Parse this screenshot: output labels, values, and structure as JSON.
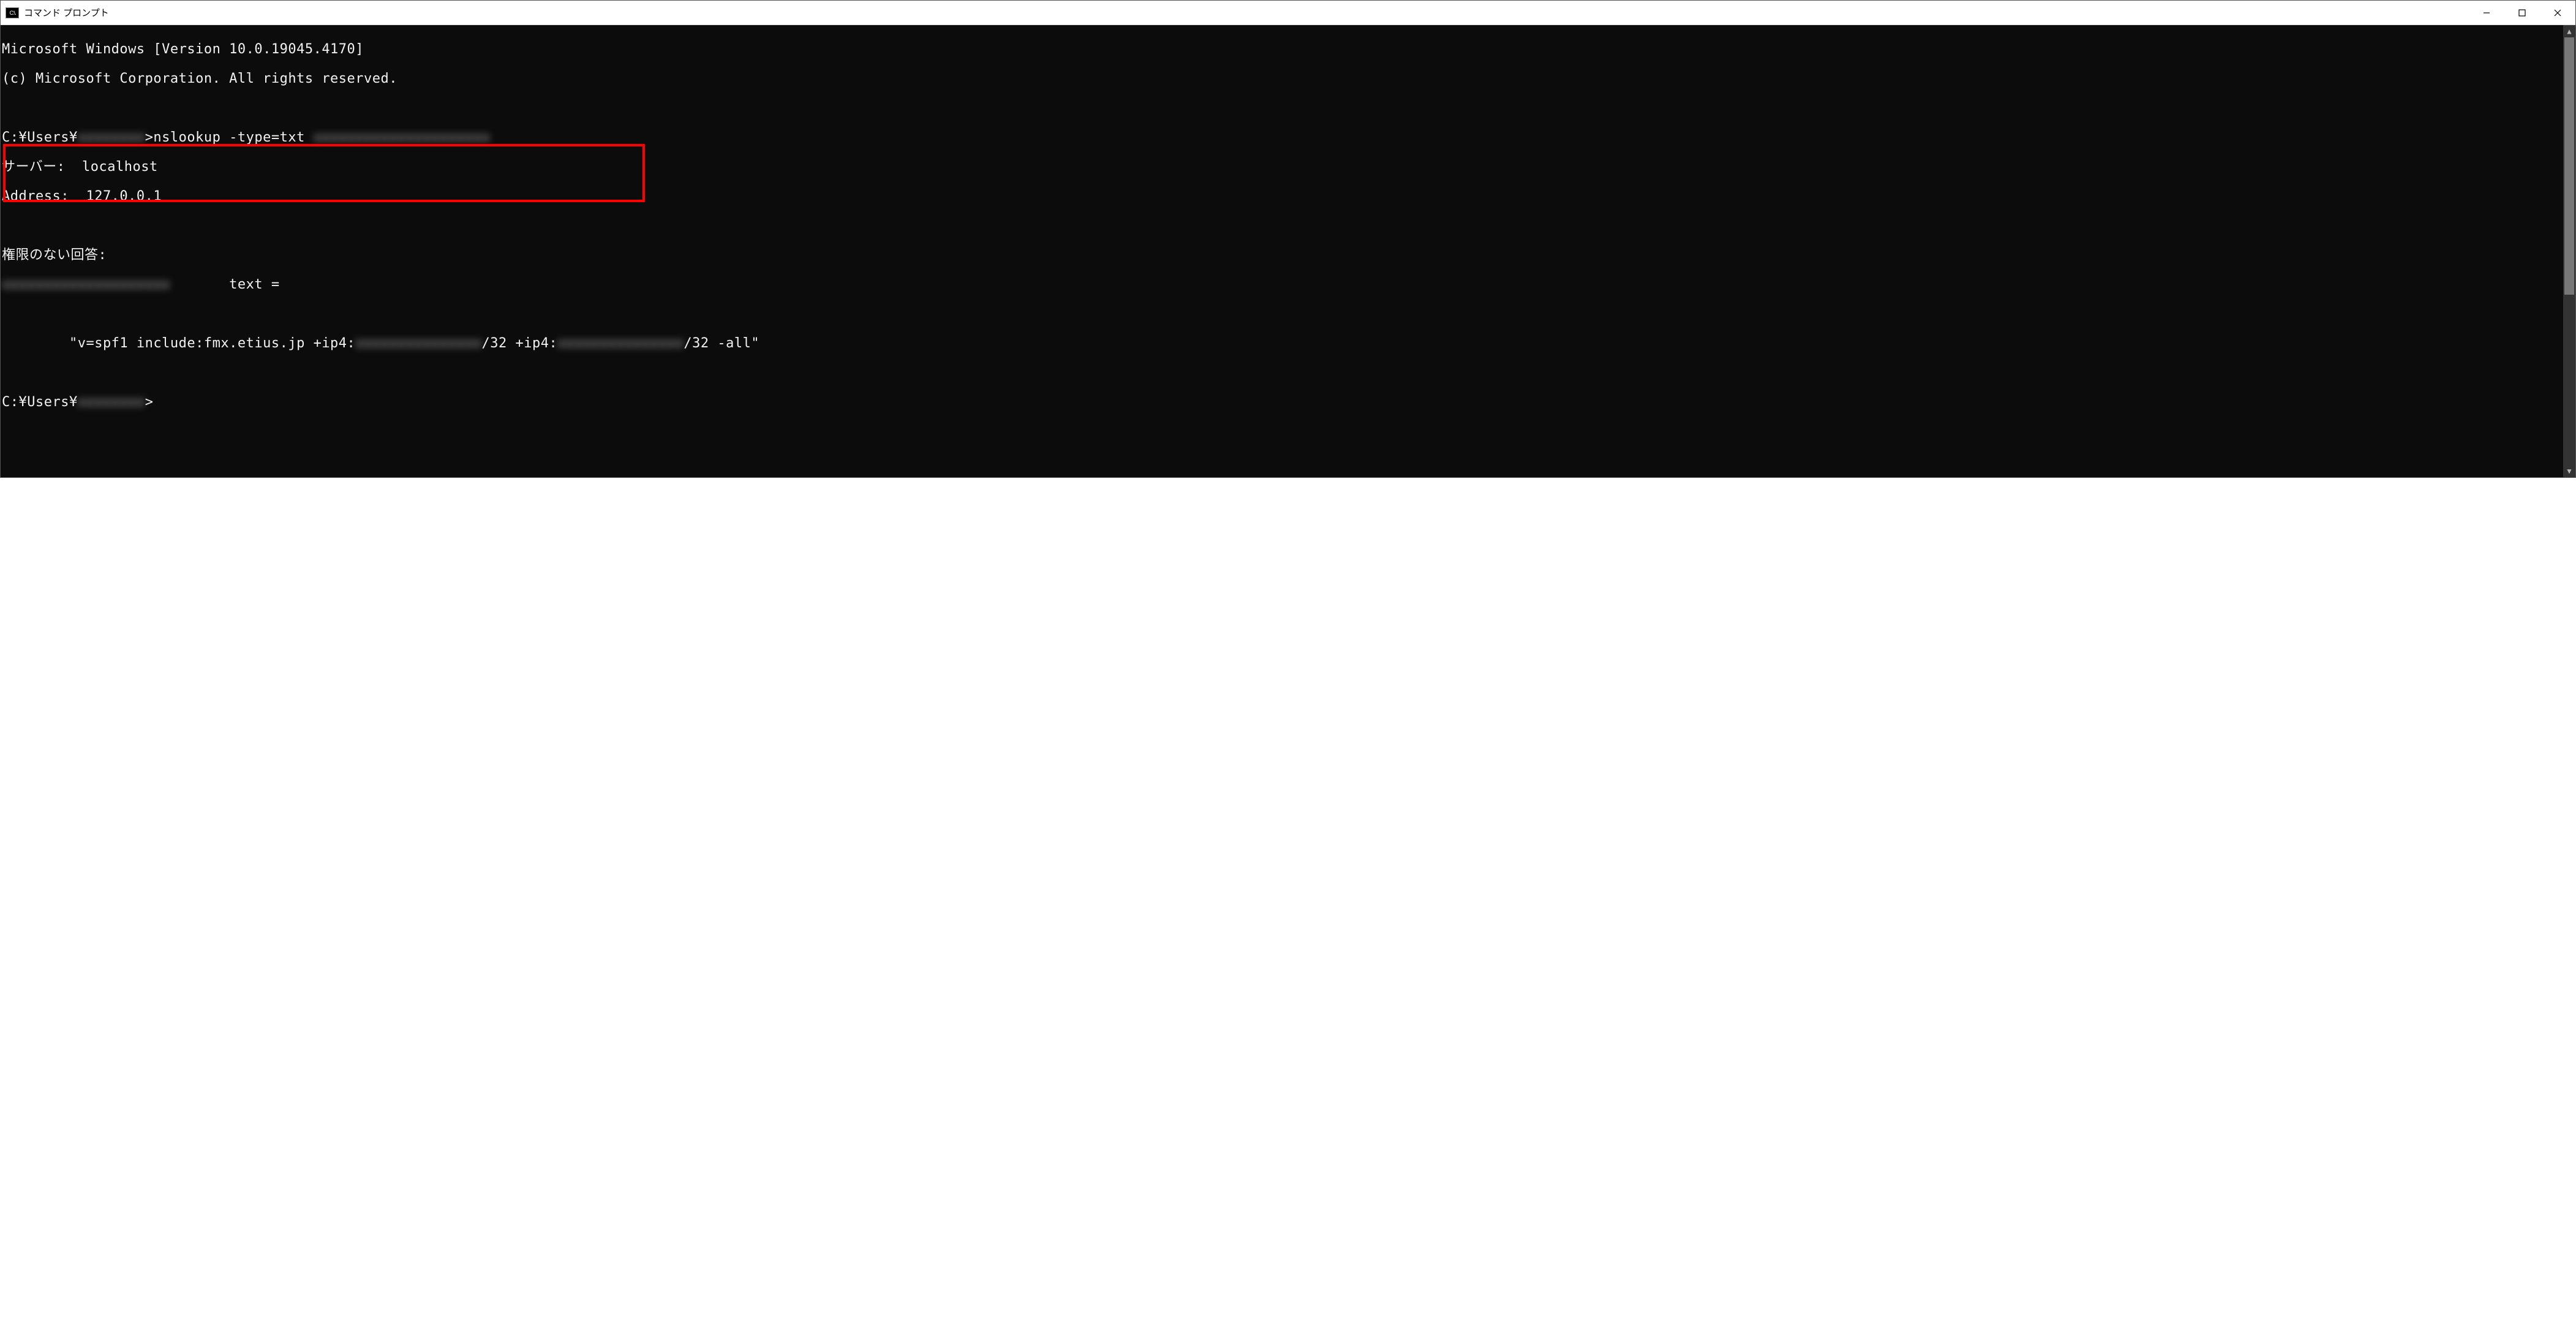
{
  "window": {
    "title": "コマンド プロンプト"
  },
  "terminal": {
    "line_version": "Microsoft Windows [Version 10.0.19045.4170]",
    "line_copyright": "(c) Microsoft Corporation. All rights reserved.",
    "prompt1_prefix": "C:¥Users¥",
    "prompt1_blur": "xxxxxxxx",
    "prompt1_cmd": ">nslookup -type=txt ",
    "prompt1_blur2": "xxxxxxxxxxxxxxxxxxxxx",
    "line_server": "サーバー:  localhost",
    "line_address": "Address:  127.0.0.1",
    "line_nonauth": "権限のない回答:",
    "line_domain_blur": "xxxxxxxxxxxxxxxxxxxx",
    "line_domain_text": "       text =",
    "spf_prefix": "        \"v=spf1 include:fmx.etius.jp +ip4:",
    "spf_blur1": "xxxxxxxxxxxxxxx",
    "spf_mid": "/32 +ip4:",
    "spf_blur2": "xxxxxxxxxxxxxxx",
    "spf_suffix": "/32 -all\"",
    "prompt2_prefix": "C:¥Users¥",
    "prompt2_blur": "xxxxxxxx",
    "prompt2_tail": ">"
  }
}
